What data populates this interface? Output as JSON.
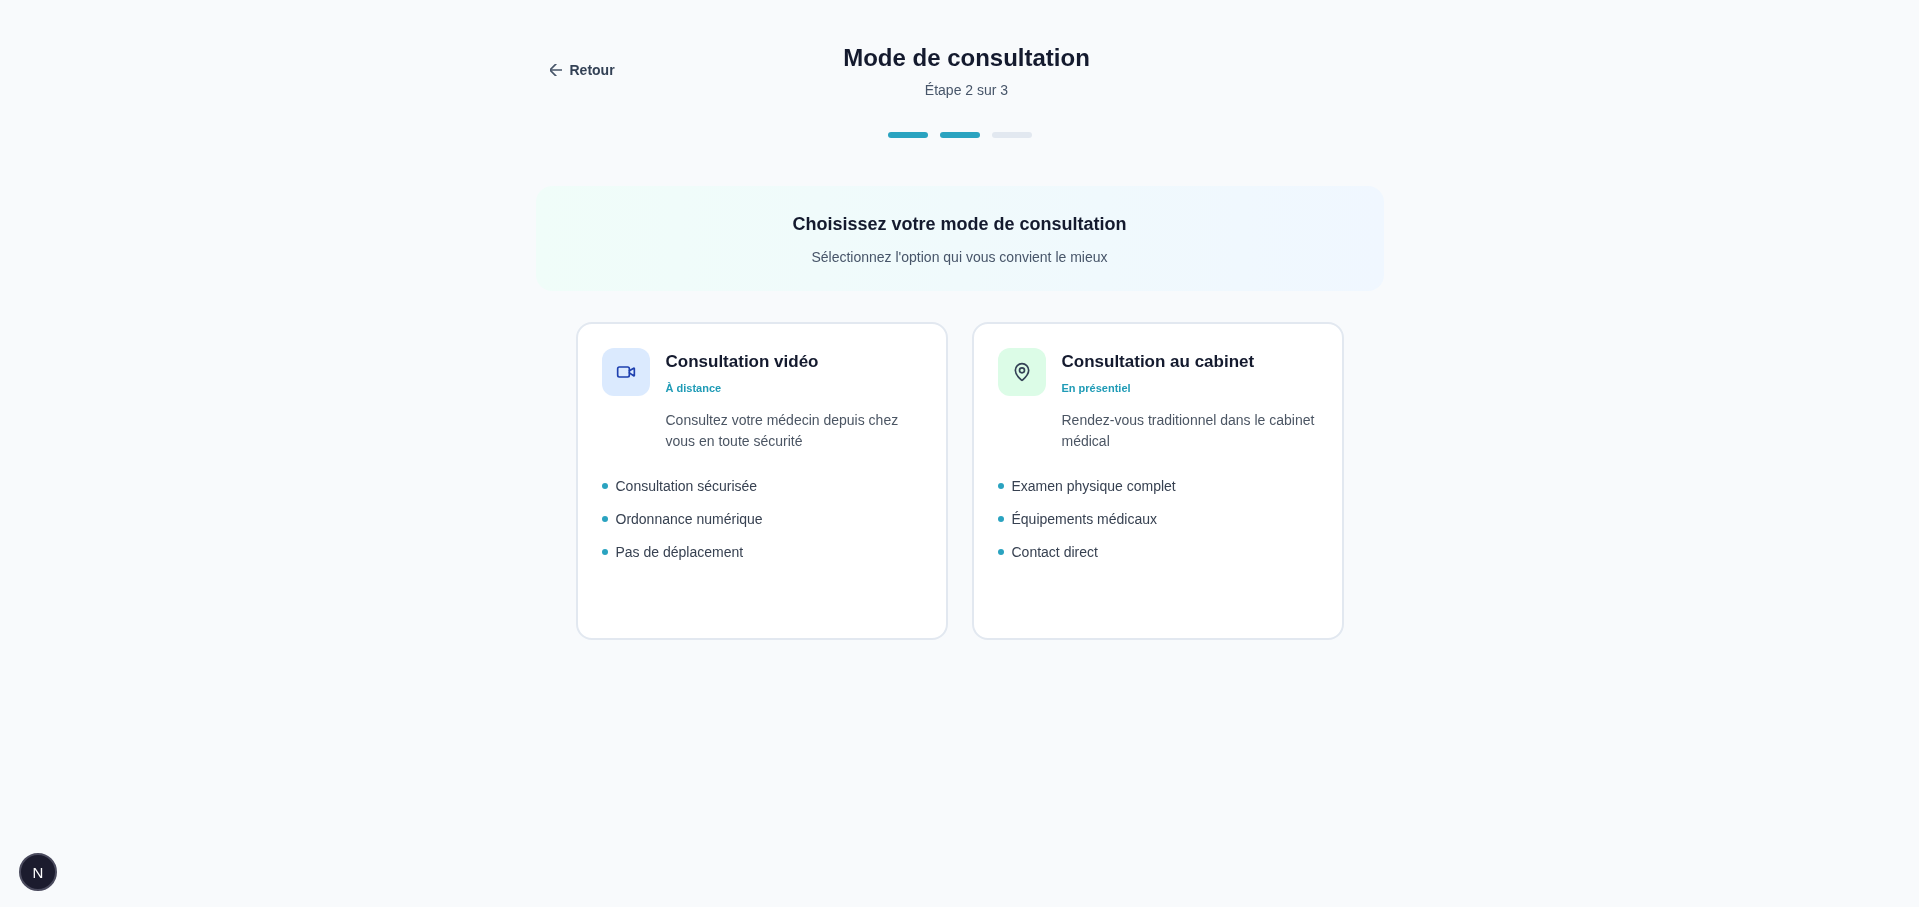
{
  "back_button": {
    "label": "Retour"
  },
  "header": {
    "title": "Mode de consultation",
    "step_label": "Étape 2 sur 3"
  },
  "progress": {
    "steps": [
      {
        "completed": true
      },
      {
        "completed": true
      },
      {
        "completed": false
      }
    ]
  },
  "intro": {
    "title": "Choisissez votre mode de consultation",
    "subtitle": "Sélectionnez l'option qui vous convient le mieux"
  },
  "options": [
    {
      "kind": "video",
      "color": "#dbeafe",
      "title": "Consultation vidéo",
      "tag": "À distance",
      "description": "Consultez votre médecin depuis chez vous en toute sécurité",
      "selected": false,
      "features": [
        "Consultation sécurisée",
        "Ordonnance numérique",
        "Pas de déplacement"
      ]
    },
    {
      "kind": "office",
      "color": "#dcfce7",
      "title": "Consultation au cabinet",
      "tag": "En présentiel",
      "description": "Rendez-vous traditionnel dans le cabinet médical",
      "selected": false,
      "features": [
        "Examen physique complet",
        "Équipements médicaux",
        "Contact direct"
      ]
    }
  ],
  "dev_indicator": {
    "label": "N"
  }
}
